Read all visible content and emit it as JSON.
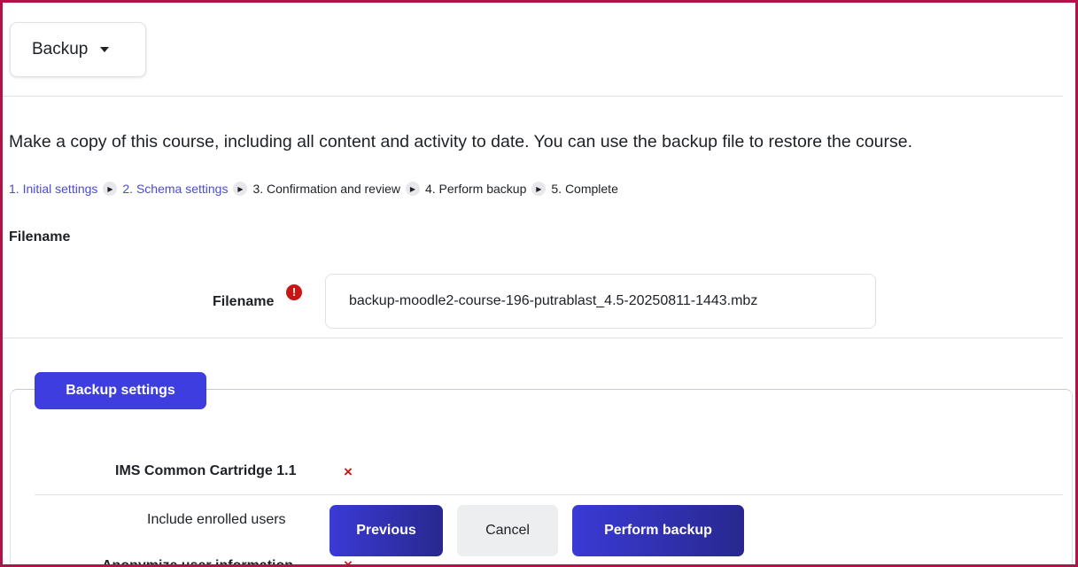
{
  "header": {
    "dropdown_label": "Backup"
  },
  "intro_text": "Make a copy of this course, including all content and activity to date. You can use the backup file to restore the course.",
  "steps": [
    {
      "label": "1. Initial settings",
      "link": true
    },
    {
      "label": "2. Schema settings",
      "link": true
    },
    {
      "label": "3. Confirmation and review",
      "link": false
    },
    {
      "label": "4. Perform backup",
      "link": false
    },
    {
      "label": "5. Complete",
      "link": false
    }
  ],
  "filename_section": {
    "heading": "Filename",
    "label": "Filename",
    "required_marker": "!",
    "value": "backup-moodle2-course-196-putrablast_4.5-20250811-1443.mbz"
  },
  "backup_settings": {
    "legend": "Backup settings",
    "items": [
      {
        "label": "IMS Common Cartridge 1.1",
        "value_icon": "cross-icon",
        "value": "×"
      },
      {
        "label": "Include enrolled users",
        "value_icon": "cross-icon",
        "value": ""
      },
      {
        "label": "Anonymize user information",
        "value_icon": "cross-icon",
        "value": "×"
      }
    ]
  },
  "buttons": {
    "previous": "Previous",
    "cancel": "Cancel",
    "perform": "Perform backup"
  },
  "colors": {
    "accent": "#3d3de0",
    "link": "#4a4ad8",
    "error": "#ca1515",
    "frame": "#b01447"
  }
}
